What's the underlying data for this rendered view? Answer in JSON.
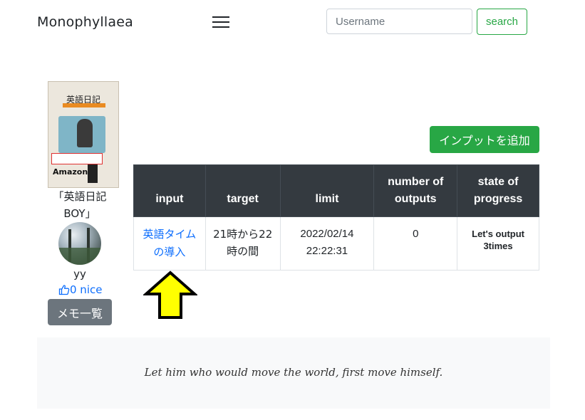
{
  "navbar": {
    "brand": "Monophyllaea",
    "search": {
      "placeholder": "Username",
      "value": ""
    },
    "search_label": "search"
  },
  "book": {
    "cover_title": "英語日記",
    "cover_amazon": "Amazon",
    "caption": "「英語日記BOY」"
  },
  "user": {
    "name": "yy",
    "nice": "0 nice"
  },
  "memo_button": "メモ一覧",
  "add_button": "インプットを追加",
  "table": {
    "headers": [
      "input",
      "target",
      "limit",
      "number of outputs",
      "state of progress"
    ],
    "rows": [
      {
        "input": "英語タイムの導入",
        "target": "21時から22時の間",
        "limit": "2022/02/14 22:22:31",
        "outputs": "0",
        "state": "Let's output 3times"
      }
    ]
  },
  "quote": "Let him who would move the world, first move himself.",
  "colors": {
    "navbar_bg": "#ffffff",
    "table_header": "#343a40",
    "success": "#28a745",
    "secondary": "#6c757d",
    "link": "#0d6efd",
    "arrow_fill": "#ffff00",
    "quote_bg": "#f8f9fa"
  },
  "icons": {
    "menu": "hamburger-menu-icon",
    "thumbs_up": "thumbs-up-icon",
    "arrow": "up-arrow-icon"
  }
}
